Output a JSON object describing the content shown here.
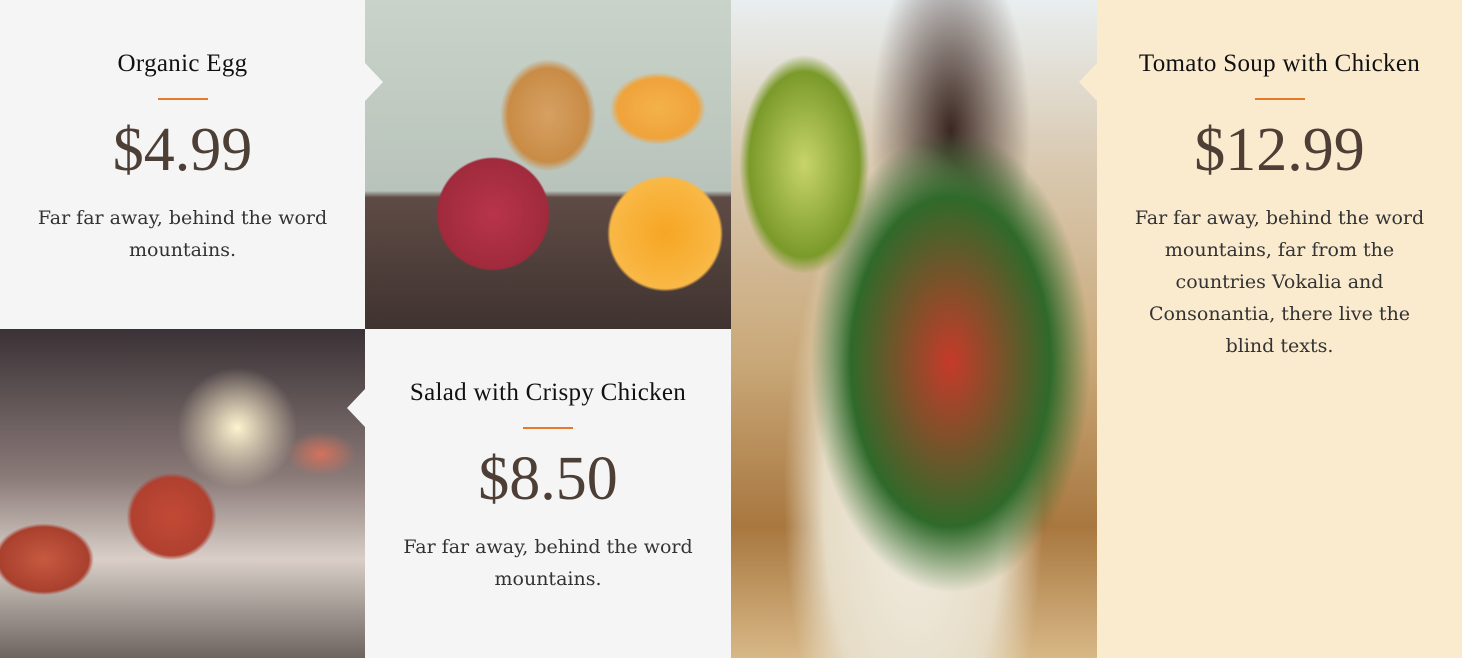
{
  "menu": [
    {
      "title": "Organic Egg",
      "price": "$4.99",
      "description": "Far far away, behind the word mountains."
    },
    {
      "title": "Salad with Crispy Chicken",
      "price": "$8.50",
      "description": "Far far away, behind the word mountains."
    },
    {
      "title": "Tomato Soup with Chicken",
      "price": "$12.99",
      "description": "Far far away, behind the word mountains, far from the countries Vokalia and Consonantia, there live the blind texts."
    }
  ],
  "colors": {
    "accent": "#e8792b",
    "grey_bg": "#f5f5f5",
    "cream_bg": "#faebcf",
    "price": "#4d3f35"
  },
  "images": [
    "drinks-apple-orange-photo",
    "rose-wine-glasses-photo",
    "tomato-salad-toast-photo"
  ]
}
